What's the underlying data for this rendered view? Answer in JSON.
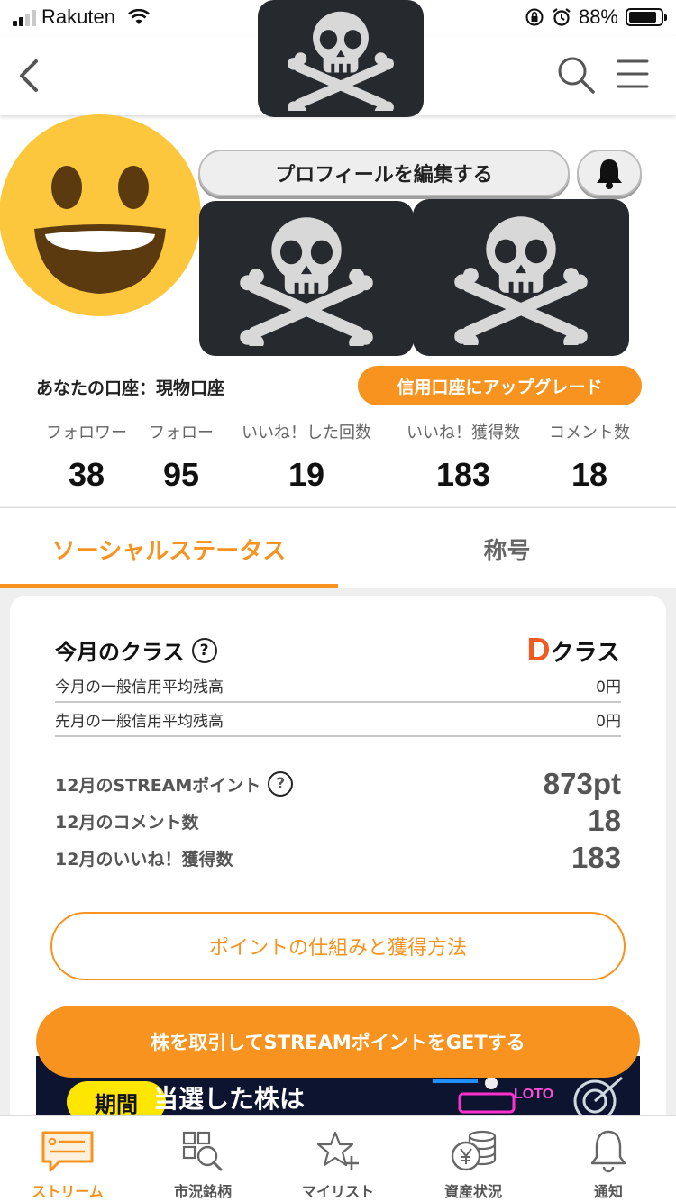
{
  "status_bar": {
    "carrier": "Rakuten",
    "battery": "88%",
    "battery_level": 0.88
  },
  "colors": {
    "accent": "#f7931e",
    "class_letter": "#f15a22",
    "skull_bg": "#262a2e"
  },
  "header": {
    "back_icon": "chevron-left-icon",
    "search_icon": "search-icon",
    "menu_icon": "hamburger-menu-icon",
    "center_icon": "skull-crossbones-icon"
  },
  "profile": {
    "avatar_icon": "grinning-face-icon",
    "edit_button": "プロフィールを編集する",
    "bell_icon": "bell-icon",
    "badge_icons": [
      "skull-crossbones-icon",
      "skull-crossbones-icon"
    ],
    "account_label": "あなたの口座：現物口座",
    "upgrade_button": "信用口座にアップグレード"
  },
  "stats": [
    {
      "label": "フォロワー",
      "value": "38"
    },
    {
      "label": "フォロー",
      "value": "95"
    },
    {
      "label": "いいね！した回数",
      "value": "19"
    },
    {
      "label": "いいね！獲得数",
      "value": "183"
    },
    {
      "label": "コメント数",
      "value": "18"
    }
  ],
  "tabs": [
    {
      "label": "ソーシャルステータス",
      "active": true
    },
    {
      "label": "称号",
      "active": false
    }
  ],
  "card": {
    "title": "今月のクラス",
    "help": "?",
    "class_letter": "D",
    "class_suffix": "クラス",
    "rows": [
      {
        "label": "今月の一般信用平均残高",
        "value": "0円"
      },
      {
        "label": "先月の一般信用平均残高",
        "value": "0円"
      }
    ],
    "points": [
      {
        "label": "12月のSTREAMポイント",
        "value": "873pt",
        "help": "?"
      },
      {
        "label": "12月のコメント数",
        "value": "18"
      },
      {
        "label": "12月のいいね！獲得数",
        "value": "183"
      }
    ],
    "outline_button": "ポイントの仕組みと獲得方法",
    "cta_button": "株を取引してSTREAMポイントをGETする"
  },
  "banner": {
    "tag": "期間",
    "headline": "当選した株は",
    "loto": "LOTO"
  },
  "bottom_nav": [
    {
      "label": "ストリーム",
      "icon": "message-board-icon",
      "active": true
    },
    {
      "label": "市況銘柄",
      "icon": "market-search-icon",
      "active": false
    },
    {
      "label": "マイリスト",
      "icon": "star-plus-icon",
      "active": false
    },
    {
      "label": "資産状況",
      "icon": "yen-coins-icon",
      "active": false
    },
    {
      "label": "通知",
      "icon": "bell-icon",
      "active": false
    }
  ]
}
